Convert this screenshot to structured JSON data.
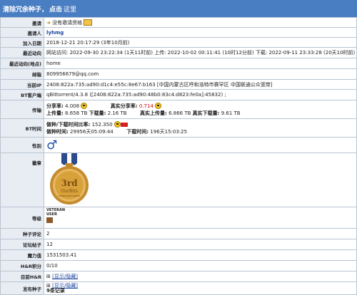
{
  "banner": {
    "title": "清除冗余种子，",
    "link1": "点击",
    "link2": "这里"
  },
  "rows": {
    "invite": {
      "label": "邀请",
      "value": "没有邀请资格"
    },
    "inviter": {
      "label": "邀请人",
      "value": "lyhmg"
    },
    "joined": {
      "label": "加入日期",
      "value": "2018-12-21 20:17:29 (3年10月前)"
    },
    "last_act": {
      "label": "最近动向",
      "value": "网站访问: 2022-09-30 23:22:34 (1天11时前) 上传: 2022-10-02 00:11:41 (10时12分前) 下载: 2022-09-11 23:33:28 (20天10时前) Tracker连接: 2022-10"
    },
    "last_loc": {
      "label": "最近动向(地点)",
      "value": "home"
    },
    "email": {
      "label": "邮箱",
      "value": "809956679@qq.com"
    },
    "ip": {
      "label": "当前IP",
      "value": "2408:822a:735:ad90:d1c4:e55c:8e67:b163 [中国内蒙古区呼和浩特市赛罕区 中国联通公众宽带]"
    },
    "client": {
      "label": "BT客户端",
      "value": "qBittorrent/4.3.8 ([2408:822a:735:ad90:48b0:83c4:d823:fe0a]:45832) ;"
    },
    "transfer": {
      "label": "传输",
      "ratio_label": "分享率:",
      "ratio": "4.008",
      "real_ratio_label": "真实分享率:",
      "real_ratio": "0.714",
      "up_label": "上传量:",
      "up": "8.658 TB",
      "down_label": "下载量:",
      "down": "2.16 TB",
      "real_up_label": "真实上传量:",
      "real_up": "6.866 TB",
      "real_down_label": "真实下载量:",
      "real_down": "9.61 TB"
    },
    "bt_time": {
      "label": "BT时间",
      "ratio_label": "做种/下载时间比率:",
      "ratio": "152.350",
      "seed_label": "做种时间:",
      "seed": "29956天05:09:44",
      "dl_label": "下载时间:",
      "dl": "196天15:03:25"
    },
    "gender": {
      "label": "性别",
      "symbol": "♂"
    },
    "medal": {
      "label": "徽章",
      "rank": "3rd",
      "brand": "OurBits",
      "small": "DISTINGUISHED SEEDER"
    },
    "class": {
      "label": "等级",
      "value": "VETERAN USER"
    },
    "comments": {
      "label": "种子评论",
      "value": "2"
    },
    "posts": {
      "label": "论坛帖子",
      "value": "12"
    },
    "magic": {
      "label": "魔力值",
      "value": "1531503.41"
    },
    "hr": {
      "label": "H&R积分",
      "value": "0/10"
    },
    "cur_hr": {
      "label": "目前H&R",
      "toggle": "⊞",
      "link": "[显示/隐藏]"
    },
    "uploaded": {
      "label": "发布种子",
      "toggle": "⊞",
      "link": "[显示/隐藏]",
      "count": "9条记录"
    }
  },
  "colors": {
    "banner": "#4a7ec3",
    "label_bg": "#e8edf4",
    "border": "#b9c4d0",
    "medal_gold": "#d9a13a",
    "ribbon": "#2b4b8c"
  }
}
